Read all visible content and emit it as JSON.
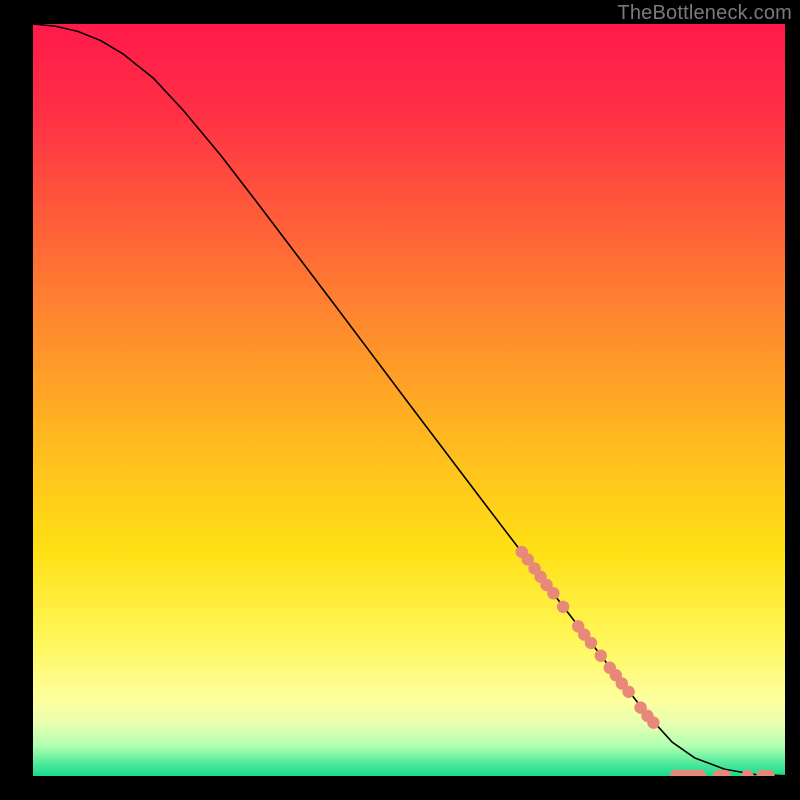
{
  "attribution": "TheBottleneck.com",
  "chart_data": {
    "type": "line",
    "title": "",
    "xlabel": "",
    "ylabel": "",
    "xlim": [
      0,
      100
    ],
    "ylim": [
      0,
      100
    ],
    "background_gradient": {
      "stops": [
        {
          "offset": 0.0,
          "color": "#ff1a4a"
        },
        {
          "offset": 0.12,
          "color": "#ff3045"
        },
        {
          "offset": 0.25,
          "color": "#ff5a3a"
        },
        {
          "offset": 0.4,
          "color": "#ff8a2e"
        },
        {
          "offset": 0.55,
          "color": "#ffb820"
        },
        {
          "offset": 0.7,
          "color": "#ffe015"
        },
        {
          "offset": 0.82,
          "color": "#fff75a"
        },
        {
          "offset": 0.9,
          "color": "#feffa0"
        },
        {
          "offset": 0.93,
          "color": "#e8ffb0"
        },
        {
          "offset": 0.96,
          "color": "#b0ffb0"
        },
        {
          "offset": 0.985,
          "color": "#4ae89a"
        },
        {
          "offset": 1.0,
          "color": "#1ad98a"
        }
      ]
    },
    "series": [
      {
        "name": "curve",
        "color": "#000000",
        "x": [
          0,
          3,
          6,
          9,
          12,
          16,
          20,
          25,
          30,
          40,
          50,
          60,
          70,
          78,
          82,
          85,
          88,
          92,
          96,
          100
        ],
        "y": [
          100,
          99.7,
          99.0,
          97.8,
          96.0,
          92.8,
          88.5,
          82.5,
          76.0,
          62.8,
          49.5,
          36.3,
          23.2,
          12.8,
          7.8,
          4.5,
          2.4,
          0.9,
          0.2,
          0.05
        ]
      },
      {
        "name": "highlighted-points",
        "type": "scatter",
        "color": "#e88878",
        "points": [
          {
            "x": 65.0,
            "y": 29.8
          },
          {
            "x": 65.8,
            "y": 28.8
          },
          {
            "x": 66.7,
            "y": 27.6
          },
          {
            "x": 67.5,
            "y": 26.5
          },
          {
            "x": 68.3,
            "y": 25.4
          },
          {
            "x": 69.2,
            "y": 24.3
          },
          {
            "x": 70.5,
            "y": 22.5
          },
          {
            "x": 72.5,
            "y": 19.9
          },
          {
            "x": 73.3,
            "y": 18.8
          },
          {
            "x": 74.2,
            "y": 17.7
          },
          {
            "x": 75.5,
            "y": 16.0
          },
          {
            "x": 76.7,
            "y": 14.4
          },
          {
            "x": 77.5,
            "y": 13.4
          },
          {
            "x": 78.3,
            "y": 12.3
          },
          {
            "x": 79.2,
            "y": 11.2
          },
          {
            "x": 80.8,
            "y": 9.1
          },
          {
            "x": 81.7,
            "y": 8.0
          },
          {
            "x": 82.5,
            "y": 7.1
          },
          {
            "x": 85.5,
            "y": 0.0
          },
          {
            "x": 86.3,
            "y": 0.0
          },
          {
            "x": 87.1,
            "y": 0.0
          },
          {
            "x": 87.9,
            "y": 0.0
          },
          {
            "x": 88.7,
            "y": 0.0
          },
          {
            "x": 91.2,
            "y": 0.0
          },
          {
            "x": 92.0,
            "y": 0.0
          },
          {
            "x": 95.0,
            "y": 0.0
          },
          {
            "x": 97.0,
            "y": 0.0
          },
          {
            "x": 97.8,
            "y": 0.0
          }
        ]
      }
    ]
  }
}
